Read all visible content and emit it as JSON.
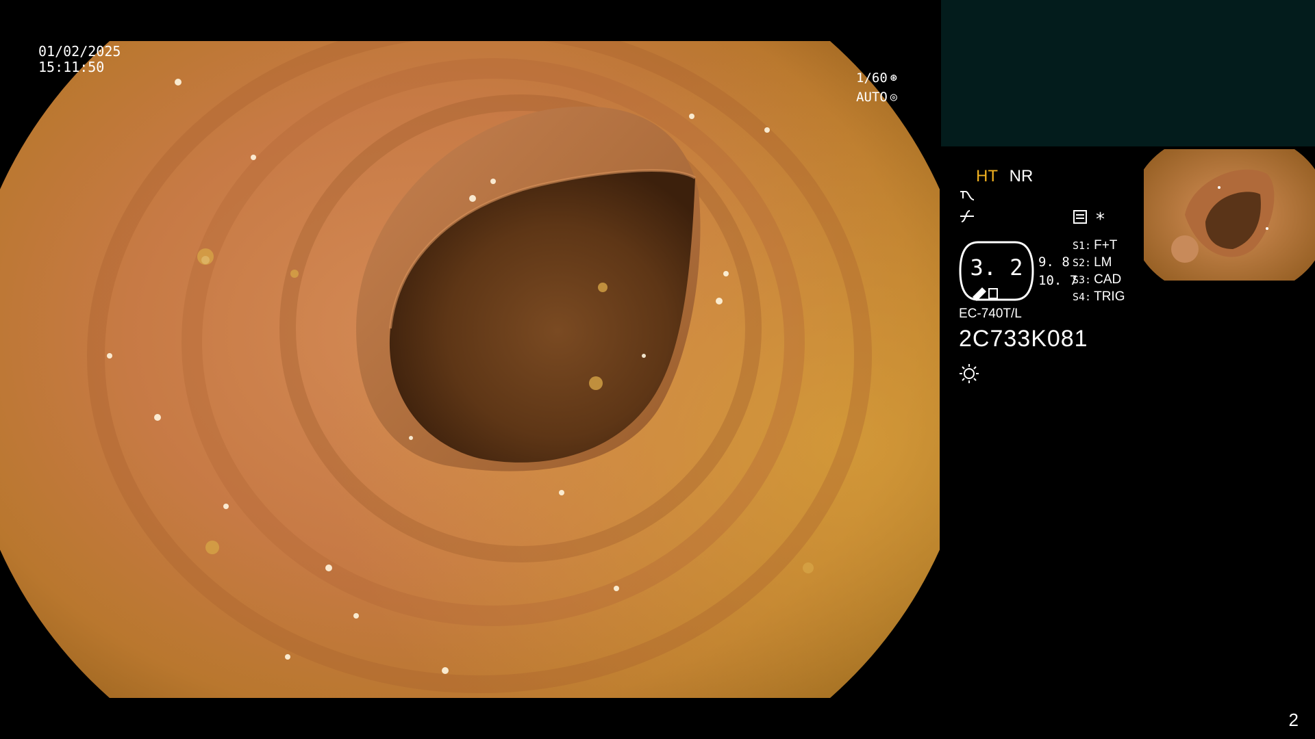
{
  "overlay": {
    "date": "01/02/2025",
    "time": "15:11:50",
    "shutter": "1/60",
    "shutter_icon": "aperture-icon",
    "iris_mode": "AUTO",
    "iris_icon": "iris-icon"
  },
  "processor": {
    "enhancement_mode": "HT",
    "noise_reduction": "NR",
    "enhancement_color": "#f0b020",
    "icons": [
      "structure-enhancement-icon",
      "color-enhancement-icon",
      "record-icon",
      "asterisk-icon",
      "brightness-icon"
    ],
    "asterisk": "*"
  },
  "zoom": {
    "value": "3. 2",
    "upper": "9. 8",
    "lower": "10. 7"
  },
  "switches": [
    {
      "key": "S1:",
      "value": "F+T"
    },
    {
      "key": "S2:",
      "value": "LM"
    },
    {
      "key": "S3:",
      "value": "CAD"
    },
    {
      "key": "S4:",
      "value": "TRIG"
    }
  ],
  "scope": {
    "model": "EC-740T/L",
    "serial": "2C733K081"
  },
  "page_number": "2",
  "colors": {
    "panel_top": "#031c1c",
    "mucosa_base": "#c9824a",
    "lumen": "#5a3418"
  }
}
